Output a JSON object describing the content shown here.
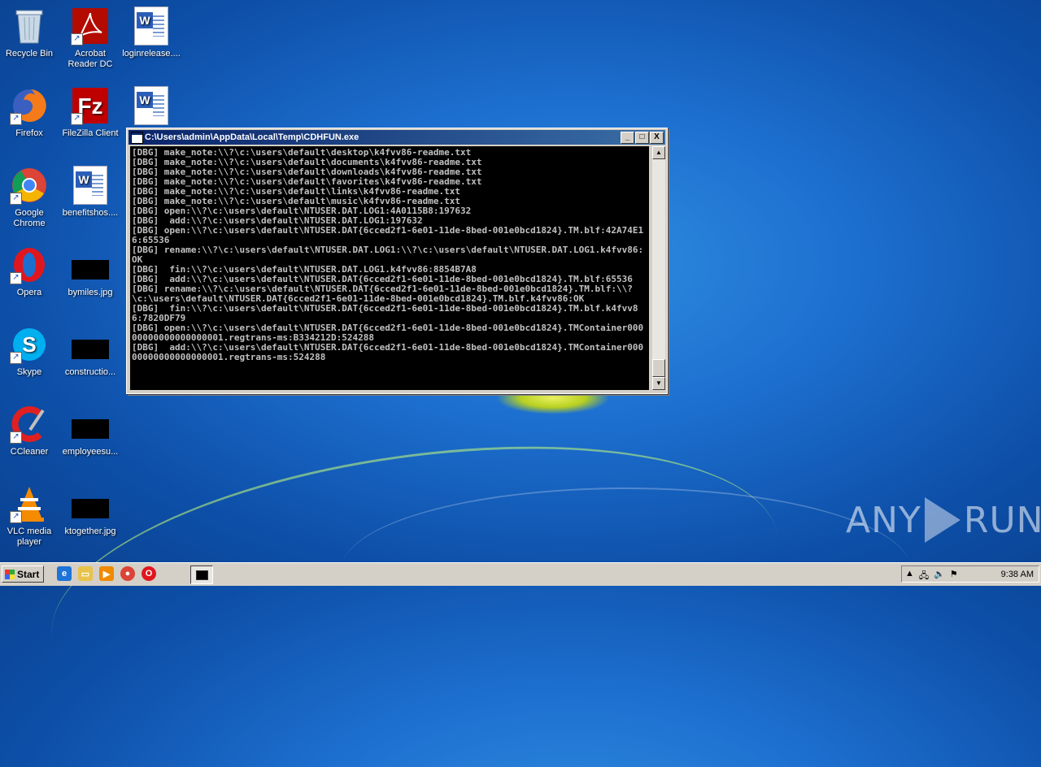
{
  "desktop": {
    "icons": [
      {
        "label": "Recycle Bin",
        "icon": "recycle-bin-icon"
      },
      {
        "label": "Acrobat Reader DC",
        "icon": "acrobat-icon"
      },
      {
        "label": "loginrelease....",
        "icon": "word-doc-icon"
      },
      {
        "label": "Firefox",
        "icon": "firefox-icon"
      },
      {
        "label": "FileZilla Client",
        "icon": "filezilla-icon"
      },
      {
        "label": "",
        "icon": "word-doc-icon"
      },
      {
        "label": "Google Chrome",
        "icon": "chrome-icon"
      },
      {
        "label": "benefitshos....",
        "icon": "word-doc-icon"
      },
      {
        "label": "Opera",
        "icon": "opera-icon"
      },
      {
        "label": "bymiles.jpg",
        "icon": "image-thumb-icon"
      },
      {
        "label": "Skype",
        "icon": "skype-icon"
      },
      {
        "label": "constructio...",
        "icon": "image-thumb-icon"
      },
      {
        "label": "CCleaner",
        "icon": "ccleaner-icon"
      },
      {
        "label": "employeesu...",
        "icon": "image-thumb-icon"
      },
      {
        "label": "VLC media player",
        "icon": "vlc-icon"
      },
      {
        "label": "ktogether.jpg",
        "icon": "image-thumb-icon"
      }
    ]
  },
  "console": {
    "title": "C:\\Users\\admin\\AppData\\Local\\Temp\\CDHFUN.exe",
    "minimize": "_",
    "maximize": "□",
    "close": "X",
    "output": "[DBG] make_note:\\\\?\\c:\\users\\default\\desktop\\k4fvv86-readme.txt\n[DBG] make_note:\\\\?\\c:\\users\\default\\documents\\k4fvv86-readme.txt\n[DBG] make_note:\\\\?\\c:\\users\\default\\downloads\\k4fvv86-readme.txt\n[DBG] make_note:\\\\?\\c:\\users\\default\\favorites\\k4fvv86-readme.txt\n[DBG] make_note:\\\\?\\c:\\users\\default\\links\\k4fvv86-readme.txt\n[DBG] make_note:\\\\?\\c:\\users\\default\\music\\k4fvv86-readme.txt\n[DBG] open:\\\\?\\c:\\users\\default\\NTUSER.DAT.LOG1:4A0115B8:197632\n[DBG]  add:\\\\?\\c:\\users\\default\\NTUSER.DAT.LOG1:197632\n[DBG] open:\\\\?\\c:\\users\\default\\NTUSER.DAT{6cced2f1-6e01-11de-8bed-001e0bcd1824}.TM.blf:42A74E16:65536\n[DBG] rename:\\\\?\\c:\\users\\default\\NTUSER.DAT.LOG1:\\\\?\\c:\\users\\default\\NTUSER.DAT.LOG1.k4fvv86:OK\n[DBG]  fin:\\\\?\\c:\\users\\default\\NTUSER.DAT.LOG1.k4fvv86:8854B7A8\n[DBG]  add:\\\\?\\c:\\users\\default\\NTUSER.DAT{6cced2f1-6e01-11de-8bed-001e0bcd1824}.TM.blf:65536\n[DBG] rename:\\\\?\\c:\\users\\default\\NTUSER.DAT{6cced2f1-6e01-11de-8bed-001e0bcd1824}.TM.blf:\\\\?\\c:\\users\\default\\NTUSER.DAT{6cced2f1-6e01-11de-8bed-001e0bcd1824}.TM.blf.k4fvv86:OK\n[DBG]  fin:\\\\?\\c:\\users\\default\\NTUSER.DAT{6cced2f1-6e01-11de-8bed-001e0bcd1824}.TM.blf.k4fvv86:7820DF79\n[DBG] open:\\\\?\\c:\\users\\default\\NTUSER.DAT{6cced2f1-6e01-11de-8bed-001e0bcd1824}.TMContainer00000000000000000001.regtrans-ms:B334212D:524288\n[DBG]  add:\\\\?\\c:\\users\\default\\NTUSER.DAT{6cced2f1-6e01-11de-8bed-001e0bcd1824}.TMContainer00000000000000000001.regtrans-ms:524288"
  },
  "watermark": {
    "left": "ANY",
    "right": "RUN"
  },
  "taskbar": {
    "start_label": "Start",
    "quicklaunch": [
      "ie-icon",
      "explorer-icon",
      "media-player-icon",
      "chrome-icon",
      "opera-icon"
    ],
    "clock": "9:38 AM"
  }
}
